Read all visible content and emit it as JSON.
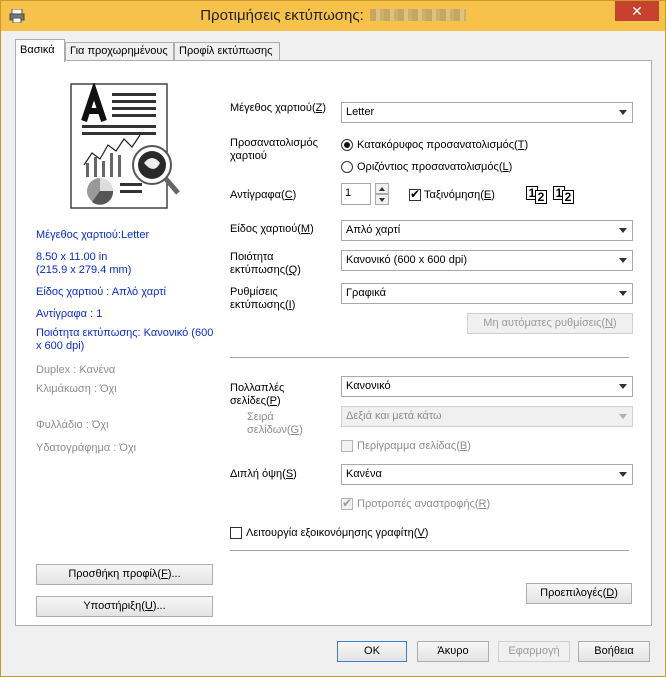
{
  "window": {
    "title": "Προτιμήσεις εκτύπωσης:",
    "close": "✕"
  },
  "tabs": [
    "Βασικά",
    "Για προχωρημένους",
    "Προφίλ εκτύπωσης"
  ],
  "summary": {
    "paper_size": "Μέγεθος χαρτιού:Letter",
    "dims1": "8.50 x 11.00 in",
    "dims2": "(215.9 x 279.4 mm)",
    "media_type": "Είδος χαρτιού : Απλό χαρτί",
    "copies": "Αντίγραφα : 1",
    "quality1": "Ποιότητα εκτύπωσης: Κανονικό (600",
    "quality2": "x 600 dpi)",
    "duplex": "Duplex : Κανένα",
    "scaling": "Κλιμάκωση : Όχι",
    "booklet": "Φυλλάδιο : Όχι",
    "watermark": "Υδατογράφημα : Όχι"
  },
  "form": {
    "paper_size": {
      "label": "Μέγεθος χαρτιού",
      "key": "Z",
      "value": "Letter"
    },
    "orientation": {
      "label1": "Προσανατολισμός",
      "label2": "χαρτιού",
      "portrait_text": "Κατακόρυφος προσανατολισμός",
      "portrait_key": "T",
      "landscape_text": "Οριζόντιος προσανατολισμός",
      "landscape_key": "L"
    },
    "copies": {
      "label": "Αντίγραφα",
      "key": "C",
      "value": "1",
      "collate": "Ταξινόμηση",
      "collate_key": "E"
    },
    "media": {
      "label": "Είδος χαρτιού",
      "key": "M",
      "value": "Απλό χαρτί"
    },
    "quality": {
      "label1": "Ποιότητα",
      "label2": "εκτύπωσης",
      "key": "Q",
      "value": "Κανονικό (600 x 600 dpi)"
    },
    "settings": {
      "label1": "Ρυθμίσεις",
      "label2": "εκτύπωσης",
      "key": "I",
      "value": "Γραφικά"
    },
    "manual_settings": {
      "text": "Μη αυτόματες ρυθμίσεις",
      "key": "N"
    },
    "multipage": {
      "label1": "Πολλαπλές",
      "label2": "σελίδες",
      "key": "P",
      "value": "Κανονικό"
    },
    "page_order": {
      "label1": "Σειρά",
      "label2": "σελίδων",
      "key": "G",
      "value": "Δεξιά και μετά κάτω"
    },
    "border": {
      "text": "Περίγραμμα σελίδας",
      "key": "B"
    },
    "duplex": {
      "label": "Διπλή όψη",
      "key": "S",
      "value": "Κανένα"
    },
    "reverse_hint": {
      "text": "Προτροπές αναστροφής",
      "key": "R"
    },
    "toner_save": {
      "text": "Λειτουργία εξοικονόμησης γραφίτη",
      "key": "V"
    }
  },
  "buttons": {
    "add_profile": {
      "text": "Προσθήκη προφίλ",
      "key": "F"
    },
    "support": {
      "text": "Υποστήριξη",
      "key": "U"
    },
    "defaults": {
      "text": "Προεπιλογές",
      "key": "D"
    },
    "ok": "OK",
    "cancel": "Άκυρο",
    "apply": "Εφαρμογή",
    "help": "Βοήθεια"
  },
  "collate_glyphs": [
    "1",
    "2",
    "1",
    "2"
  ],
  "colors": {
    "titlebar": "#f6c24a",
    "close": "#c7412f",
    "summary_text": "#0a2ad8",
    "disabled_text": "#8d8d8d"
  }
}
